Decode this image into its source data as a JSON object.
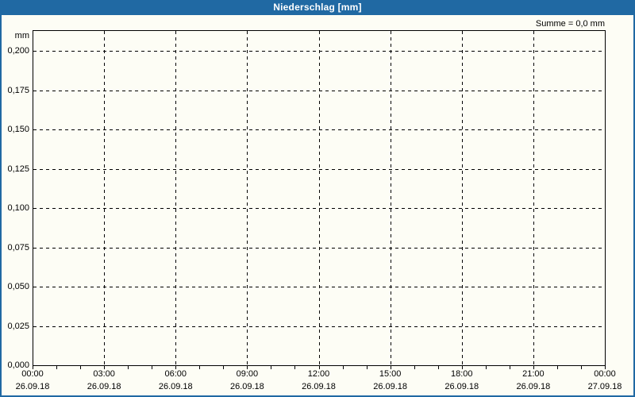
{
  "window": {
    "title": "Niederschlag [mm]"
  },
  "colors": {
    "header_bg": "#2069a3",
    "frame_border": "#2069a3",
    "background": "#fdfdf5",
    "grid": "#000000",
    "title_text": "#ffffff",
    "label_text": "#000000"
  },
  "chart_data": {
    "type": "bar",
    "title": "Niederschlag [mm]",
    "ylabel": "mm",
    "annotation": "Summe = 0,0 mm",
    "sum_mm": "0,0",
    "grid": "dashed",
    "legend": null,
    "ylim": [
      0,
      0.213
    ],
    "y_ticks": [
      {
        "value": 0.0,
        "label": "0,000"
      },
      {
        "value": 0.025,
        "label": "0,025"
      },
      {
        "value": 0.05,
        "label": "0,050"
      },
      {
        "value": 0.075,
        "label": "0,075"
      },
      {
        "value": 0.1,
        "label": "0,100"
      },
      {
        "value": 0.125,
        "label": "0,125"
      },
      {
        "value": 0.15,
        "label": "0,150"
      },
      {
        "value": 0.175,
        "label": "0,175"
      },
      {
        "value": 0.2,
        "label": "0,200"
      }
    ],
    "x_axis": {
      "range_hours": [
        0,
        24
      ],
      "minor_tick_every_hours": 1,
      "gridline_hours": [
        3,
        6,
        9,
        12,
        15,
        18,
        21
      ],
      "major_ticks": [
        {
          "hour": 0,
          "time": "00:00",
          "date": "26.09.18"
        },
        {
          "hour": 3,
          "time": "03:00",
          "date": "26.09.18"
        },
        {
          "hour": 6,
          "time": "06:00",
          "date": "26.09.18"
        },
        {
          "hour": 9,
          "time": "09:00",
          "date": "26.09.18"
        },
        {
          "hour": 12,
          "time": "12:00",
          "date": "26.09.18"
        },
        {
          "hour": 15,
          "time": "15:00",
          "date": "26.09.18"
        },
        {
          "hour": 18,
          "time": "18:00",
          "date": "26.09.18"
        },
        {
          "hour": 21,
          "time": "21:00",
          "date": "26.09.18"
        },
        {
          "hour": 24,
          "time": "00:00",
          "date": "27.09.18"
        }
      ]
    },
    "series": [],
    "values": []
  }
}
